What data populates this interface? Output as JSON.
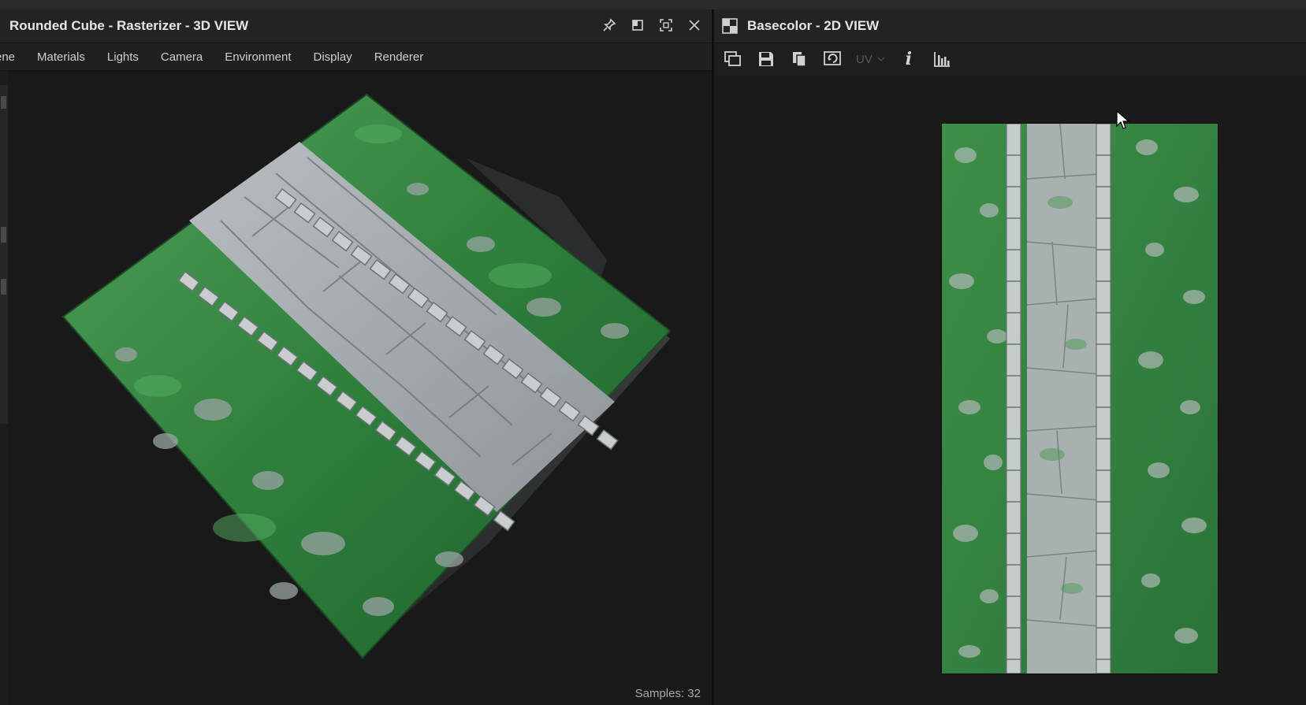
{
  "panel3d": {
    "title": "Rounded Cube - Rasterizer - 3D VIEW",
    "menu": [
      "ene",
      "Materials",
      "Lights",
      "Camera",
      "Environment",
      "Display",
      "Renderer"
    ],
    "samples_label": "Samples: 32",
    "title_icons": [
      "pin-icon",
      "dock-icon",
      "maximize-icon",
      "close-icon"
    ]
  },
  "panel2d": {
    "title": "Basecolor - 2D VIEW",
    "toolbar": {
      "icons": [
        "export-icon",
        "save-icon",
        "copy-icon",
        "refresh-icon",
        "uv-dropdown",
        "info-icon",
        "histogram-icon"
      ],
      "uv_label": "UV",
      "info_label": "i"
    }
  },
  "colors": {
    "background": "#1b1b1b",
    "titlebar": "#232323",
    "grass": "#3a8a45",
    "stone": "#aeb4b6"
  }
}
